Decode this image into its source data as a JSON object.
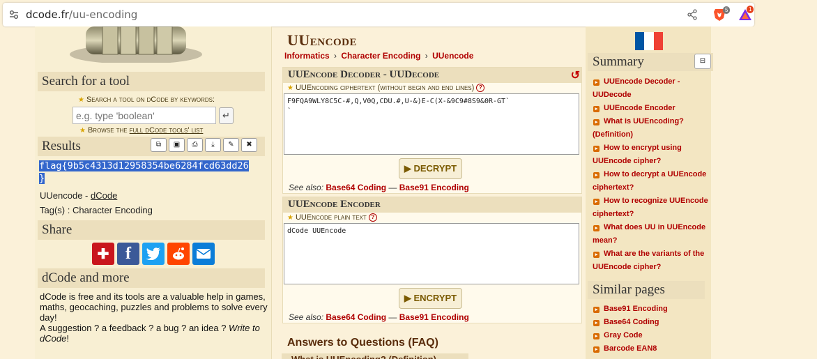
{
  "browser": {
    "domain": "dcode.fr",
    "path": "/uu-encoding",
    "brave_badge": "5",
    "rewards_badge": "1"
  },
  "left": {
    "search_title": "Search for a tool",
    "keyword_label": "Search a tool on dCode by keywords:",
    "search_placeholder": "e.g. type 'boolean'",
    "go_glyph": "↵",
    "browse_pre": "Browse the ",
    "browse_link": "full dCode tools' list",
    "results_title": "Results",
    "result_line1": "flag{9b5c4313d12958354be6284fcd63dd26",
    "result_line2": "}",
    "uuencode_label": "UUencode - ",
    "uuencode_link": "dCode",
    "tags_line": "Tag(s) : Character Encoding",
    "share_title": "Share",
    "more_title": "dCode and more",
    "about_text": "dCode is free and its tools are a valuable help in games, maths, geocaching, puzzles and problems to solve every day!",
    "suggest_text": "A suggestion ? a feedback ? a bug ? an idea ? ",
    "write_to": "Write to dCode",
    "write_end": "!"
  },
  "center": {
    "title": "UUencode",
    "breadcrumb": [
      "Informatics",
      "Character Encoding",
      "UUencode"
    ],
    "crumb_sep": "›",
    "decoder_title": "UUEncode Decoder - UUDecode",
    "cipher_label": "UUEncoding ciphertext (without begin and end lines)",
    "cipher_text": "F9FQA9WLY8C5C-#,Q,V0Q,CDU.#,U-&)E-C(X-&9C9#8S9&0R-GT`\n`",
    "decrypt_label": "▶ DECRYPT",
    "seealso_label": "See also: ",
    "seealso_a": "Base64 Coding",
    "seealso_sep": " — ",
    "seealso_b": "Base91 Encoding",
    "encoder_title": "UUEncode Encoder",
    "plain_label": "UUEncode plain text",
    "plain_text": "dCode UUEncode",
    "encrypt_label": "▶ ENCRYPT",
    "faq_title": "Answers to Questions (FAQ)",
    "faq_first": "What is UUEncoding? (Definition)"
  },
  "right": {
    "summary_title": "Summary",
    "summary_items": [
      "UUEncode Decoder - UUDecode",
      "UUEncode Encoder",
      "What is UUEncoding? (Definition)",
      "How to encrypt using UUEncode cipher?",
      "How to decrypt a UUEncode ciphertext?",
      "How to recognize UUEncode ciphertext?",
      "What does UU in UUEncode mean?",
      "What are the variants of the UUEncode cipher?"
    ],
    "similar_title": "Similar pages",
    "similar_items": [
      "Base91 Encoding",
      "Base64 Coding",
      "Gray Code",
      "Barcode EAN8"
    ]
  },
  "colors": {
    "accent": "#b00000",
    "highlight": "#3366cc",
    "section": "#ecdfbd",
    "flag_blue": "#0055a4",
    "flag_red": "#ef4135"
  }
}
